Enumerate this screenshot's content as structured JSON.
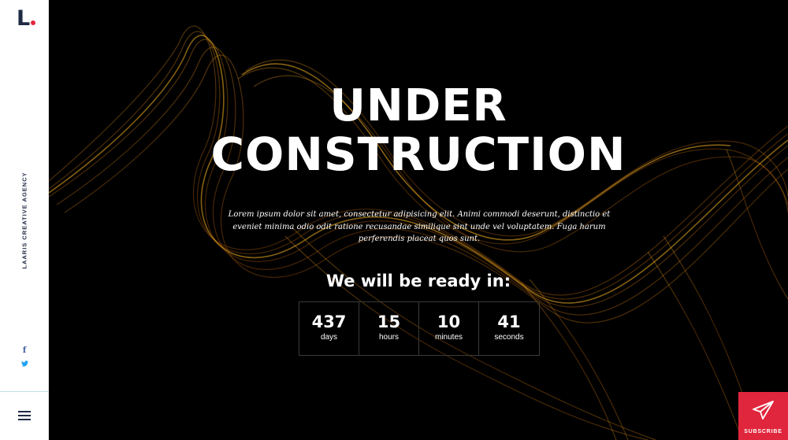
{
  "brand": {
    "logo_letter": "L",
    "tagline": "LAARIS CREATIVE AGENCY",
    "accent_color": "#e0263c",
    "dark_color": "#1f2a44"
  },
  "social": {
    "facebook_glyph": "f",
    "twitter_glyph": "🐦",
    "icons": [
      "facebook-icon",
      "twitter-icon"
    ]
  },
  "menu": {
    "icon": "hamburger-icon"
  },
  "hero": {
    "title_line1": "UNDER",
    "title_line2": "CONSTRUCTION",
    "description": "Lorem ipsum dolor sit amet, consectetur adipisicing elit. Animi commodi deserunt, distinctio et eveniet minima odio odit ratione recusandae similique sint unde vel voluptatem. Fuga harum perferendis placeat quos sunt.",
    "ready_text": "We will be ready in:",
    "wave_color": "#d98a1a"
  },
  "countdown": [
    {
      "value": "437",
      "unit": "days"
    },
    {
      "value": "15",
      "unit": "hours"
    },
    {
      "value": "10",
      "unit": "minutes"
    },
    {
      "value": "41",
      "unit": "seconds"
    }
  ],
  "subscribe": {
    "label": "SUBSCRIBE",
    "icon": "paper-plane-icon"
  }
}
